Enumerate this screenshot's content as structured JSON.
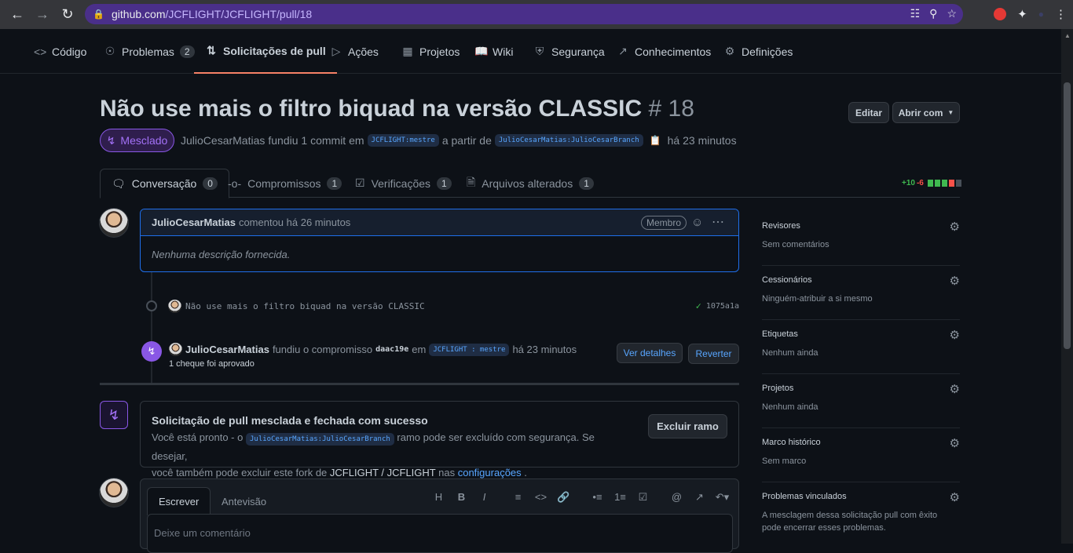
{
  "browser": {
    "url_host": "github.com",
    "url_path": "/JCFLIGHT/JCFLIGHT/pull/18"
  },
  "repo_nav": [
    {
      "label": "Código",
      "icon": "code-icon"
    },
    {
      "label": "Problemas",
      "icon": "issue-icon",
      "count": "2"
    },
    {
      "label": "Solicitações de pull",
      "icon": "pull-request-icon",
      "active": true
    },
    {
      "label": "Ações",
      "icon": "play-icon"
    },
    {
      "label": "Projetos",
      "icon": "project-icon"
    },
    {
      "label": "Wiki",
      "icon": "book-icon"
    },
    {
      "label": "Segurança",
      "icon": "shield-icon"
    },
    {
      "label": "Conhecimentos",
      "icon": "graph-icon"
    },
    {
      "label": "Definições",
      "icon": "gear-icon"
    }
  ],
  "pr": {
    "title": "Não use mais o filtro biquad na versão CLASSIC",
    "number": "# 18",
    "edit_label": "Editar",
    "open_with_label": "Abrir com",
    "state": "Mesclado",
    "author": "JulioCesarMatias",
    "merged_text": "fundiu 1 commit em",
    "base_branch": "JCFLIGHT:mestre",
    "from_text": "a partir de",
    "head_branch": "JulioCesarMatias:JulioCesarBranch",
    "time": "há 23 minutos"
  },
  "pr_tabs": [
    {
      "label": "Conversação",
      "count": "0",
      "icon": "comment-icon",
      "active": true
    },
    {
      "label": "Compromissos",
      "count": "1",
      "icon": "commit-icon"
    },
    {
      "label": "Verificações",
      "count": "1",
      "icon": "checklist-icon"
    },
    {
      "label": "Arquivos alterados",
      "count": "1",
      "icon": "file-diff-icon"
    }
  ],
  "diffstat": {
    "additions": "+10",
    "deletions": "-6"
  },
  "comment": {
    "author": "JulioCesarMatias",
    "action": "comentou há 26 minutos",
    "badge": "Membro",
    "body": "Nenhuma descrição fornecida."
  },
  "commit": {
    "message": "Não use mais o filtro biquad na versão CLASSIC",
    "sha": "1075a1a"
  },
  "merge_event": {
    "author": "JulioCesarMatias",
    "text1": "fundiu o compromisso",
    "sha": "daac19e",
    "text2": "em",
    "branch": "JCFLIGHT : mestre",
    "time": "há 23 minutos",
    "check": "1 cheque foi aprovado",
    "details_label": "Ver detalhes",
    "revert_label": "Reverter"
  },
  "merged_box": {
    "title": "Solicitação de pull mesclada e fechada com sucesso",
    "line1_pre": "Você está pronto - o",
    "branch": "JulioCesarMatias:JulioCesarBranch",
    "line1_post": "ramo pode ser excluído com segurança. Se desejar,",
    "line2_pre": "você também pode excluir este fork de",
    "repo": "JCFLIGHT / JCFLIGHT",
    "line2_mid": "nas",
    "link": "configurações",
    "line2_post": ".",
    "delete_label": "Excluir ramo"
  },
  "editor": {
    "write_tab": "Escrever",
    "preview_tab": "Antevisão",
    "placeholder": "Deixe um comentário"
  },
  "sidebar": [
    {
      "title": "Revisores",
      "value": "Sem comentários"
    },
    {
      "title": "Cessionários",
      "value": "Ninguém-atribuir a si mesmo"
    },
    {
      "title": "Etiquetas",
      "value": "Nenhum ainda"
    },
    {
      "title": "Projetos",
      "value": "Nenhum ainda"
    },
    {
      "title": "Marco histórico",
      "value": "Sem marco"
    },
    {
      "title": "Problemas vinculados",
      "value": "A mesclagem dessa solicitação pull com êxito pode encerrar esses problemas."
    }
  ],
  "colors": {
    "accent_merged": "#8957e5",
    "link": "#58a6ff",
    "add": "#3fb950",
    "del": "#f85149"
  }
}
